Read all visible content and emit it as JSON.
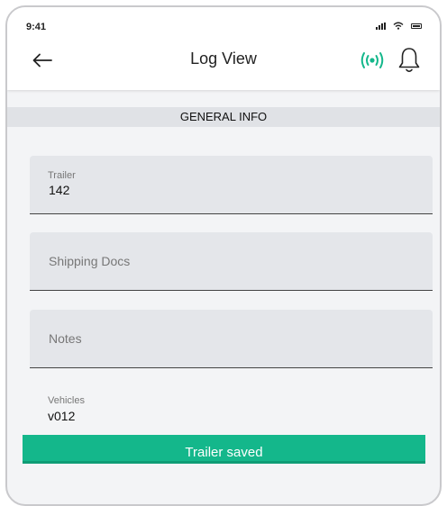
{
  "status_bar": {
    "time": "9:41"
  },
  "header": {
    "title": "Log View"
  },
  "section": {
    "title": "GENERAL INFO"
  },
  "fields": {
    "trailer": {
      "label": "Trailer",
      "value": "142"
    },
    "shipping_docs": {
      "placeholder": "Shipping Docs"
    },
    "notes": {
      "placeholder": "Notes"
    },
    "vehicles": {
      "label": "Vehicles",
      "value": "v012"
    }
  },
  "toast": {
    "message": "Trailer saved"
  },
  "colors": {
    "accent": "#14b78b",
    "field_bg": "#e4e6ea",
    "section_bg": "#e0e2e6"
  }
}
